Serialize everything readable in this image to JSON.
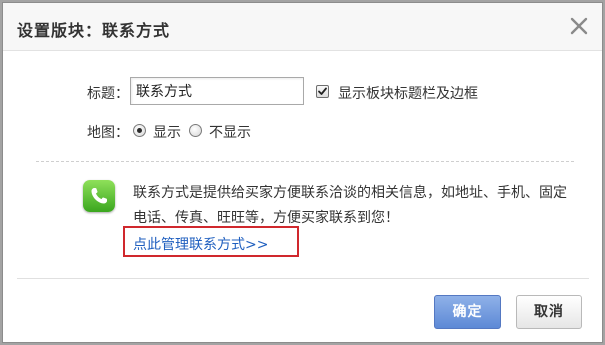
{
  "dialog": {
    "title": "设置版块：联系方式"
  },
  "form": {
    "title_label": "标题：",
    "title_value": "联系方式",
    "show_titlebar_label": "显示板块标题栏及边框",
    "show_titlebar_checked": true,
    "map_label": "地图：",
    "map_options": [
      "显示",
      "不显示"
    ],
    "map_selected": "显示"
  },
  "info": {
    "description": "联系方式是提供给买家方便联系洽谈的相关信息，如地址、手机、固定电话、传真、旺旺等，方便买家联系到您！",
    "manage_link": "点此管理联系方式>>"
  },
  "buttons": {
    "ok": "确定",
    "cancel": "取消"
  },
  "icons": {
    "close": "close-icon",
    "phone": "phone-icon",
    "checkbox": "checkmark-icon"
  },
  "colors": {
    "link": "#1f5fbf",
    "highlight_border": "#d0282d",
    "primary_button": "#6f97dc",
    "phone_icon": "#4cb82c"
  }
}
